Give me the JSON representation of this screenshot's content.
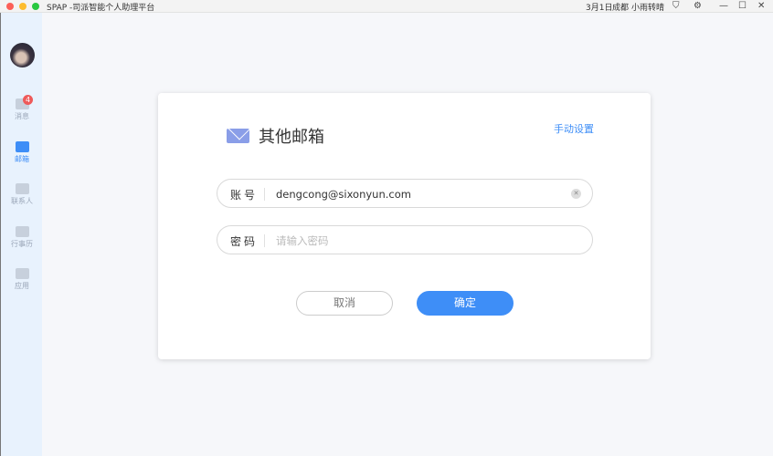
{
  "window": {
    "title": "SPAP -司派智能个人助理平台",
    "date": "3月1日",
    "city": "成都",
    "weather": "小雨转晴"
  },
  "sidebar": {
    "items": [
      {
        "label": "消息",
        "badge": "4"
      },
      {
        "label": "邮箱"
      },
      {
        "label": "联系人"
      },
      {
        "label": "行事历"
      },
      {
        "label": "应用"
      }
    ]
  },
  "dialog": {
    "title": "其他邮箱",
    "manual_setup": "手动设置",
    "account": {
      "label": "账号",
      "value": "dengcong@sixonyun.com"
    },
    "password": {
      "label": "密码",
      "placeholder": "请输入密码",
      "value": ""
    },
    "cancel": "取消",
    "confirm": "确定"
  },
  "colors": {
    "accent": "#3e8ef7",
    "badge": "#ee5a5a"
  }
}
